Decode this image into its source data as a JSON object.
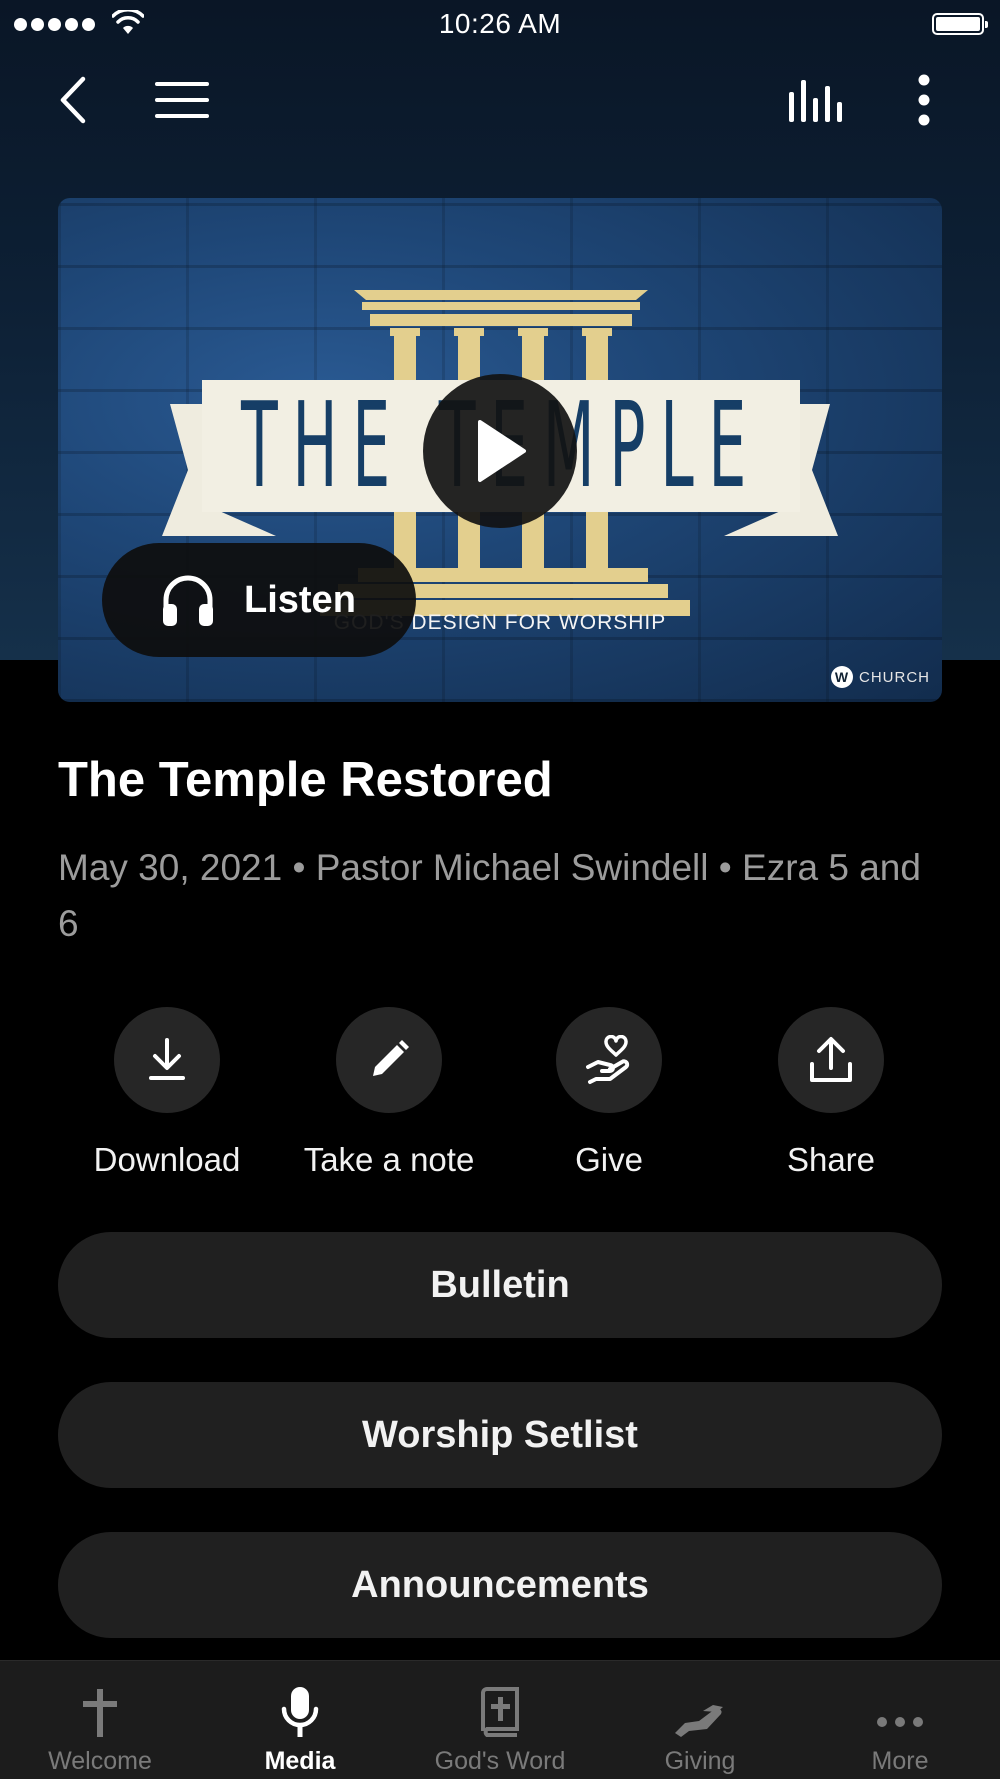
{
  "status_bar": {
    "time": "10:26 AM"
  },
  "nav": {
    "back_icon": "chevron-left-icon",
    "menu_icon": "hamburger-icon",
    "audio_icon": "equalizer-bars-icon",
    "more_icon": "vertical-dots-icon"
  },
  "media": {
    "artwork_title": "THE TEMPLE",
    "artwork_subtitle": "GOD'S DESIGN FOR WORSHIP",
    "watermark": "CHURCH",
    "listen_label": "Listen",
    "play_icon": "play-icon"
  },
  "sermon": {
    "title": "The Temple Restored",
    "meta": "May 30, 2021 • Pastor Michael Swindell • Ezra 5 and 6"
  },
  "actions": [
    {
      "label": "Download",
      "icon": "download-icon"
    },
    {
      "label": "Take a note",
      "icon": "pencil-icon"
    },
    {
      "label": "Give",
      "icon": "hand-heart-icon"
    },
    {
      "label": "Share",
      "icon": "share-icon"
    }
  ],
  "buttons": {
    "bulletin": "Bulletin",
    "setlist": "Worship Setlist",
    "announcements": "Announcements"
  },
  "tab_bar": {
    "active": "Media",
    "tabs": [
      {
        "label": "Welcome",
        "icon": "cross-icon"
      },
      {
        "label": "Media",
        "icon": "microphone-icon"
      },
      {
        "label": "God's Word",
        "icon": "bible-icon"
      },
      {
        "label": "Giving",
        "icon": "giving-hand-icon"
      },
      {
        "label": "More",
        "icon": "more-dots-icon"
      }
    ]
  },
  "colors": {
    "background": "#000000",
    "header_gradient": "#0d2035",
    "button_bg": "#202020",
    "artwork_blue": "#1e4676",
    "artwork_gold": "#e3cf8e"
  }
}
